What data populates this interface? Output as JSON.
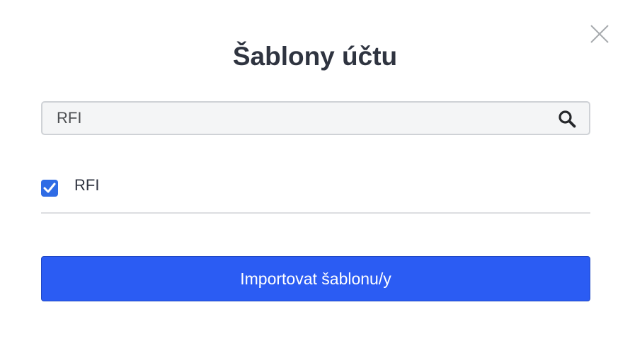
{
  "dialog": {
    "title": "Šablony účtu",
    "close_icon": "close-icon"
  },
  "search": {
    "value": "RFI",
    "icon": "search-icon"
  },
  "templates": [
    {
      "label": "RFI",
      "checked": true
    }
  ],
  "actions": {
    "import_label": "Importovat šablonu/y"
  },
  "colors": {
    "primary": "#2b5cf3",
    "checkbox": "#2f6ce5",
    "title": "#2f3440"
  }
}
